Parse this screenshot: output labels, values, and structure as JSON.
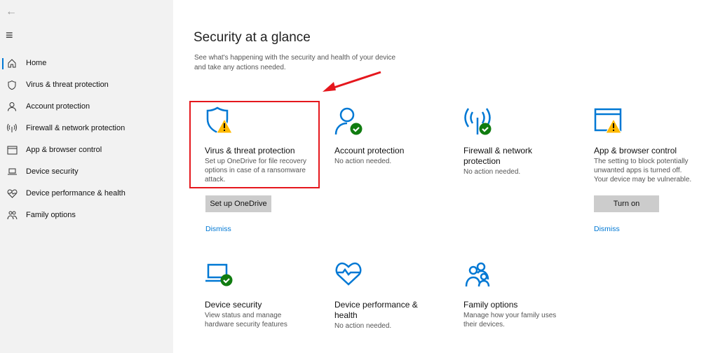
{
  "sidebar": {
    "back": "←",
    "menu": "≡",
    "items": [
      {
        "label": "Home",
        "icon": "home-icon"
      },
      {
        "label": "Virus & threat protection",
        "icon": "shield-icon"
      },
      {
        "label": "Account protection",
        "icon": "person-icon"
      },
      {
        "label": "Firewall & network protection",
        "icon": "antenna-icon"
      },
      {
        "label": "App & browser control",
        "icon": "browser-window-icon"
      },
      {
        "label": "Device security",
        "icon": "laptop-icon"
      },
      {
        "label": "Device performance & health",
        "icon": "heart-icon"
      },
      {
        "label": "Family options",
        "icon": "family-icon"
      }
    ]
  },
  "main": {
    "title": "Security at a glance",
    "subtitle": "See what's happening with the security and health of your device and take any actions needed.",
    "cards": [
      {
        "title": "Virus & threat protection",
        "desc": "Set up OneDrive for file recovery options in case of a ransomware attack.",
        "status": "warning",
        "button": "Set up OneDrive",
        "dismiss": "Dismiss"
      },
      {
        "title": "Account protection",
        "desc": "No action needed.",
        "status": "ok"
      },
      {
        "title": "Firewall & network protection",
        "desc": "No action needed.",
        "status": "ok"
      },
      {
        "title": "App & browser control",
        "desc": "The setting to block potentially unwanted apps is turned off. Your device may be vulnerable.",
        "status": "warning",
        "button": "Turn on",
        "dismiss": "Dismiss"
      },
      {
        "title": "Device security",
        "desc": "View status and manage hardware security features",
        "status": "ok"
      },
      {
        "title": "Device performance & health",
        "desc": "No action needed.",
        "status": "none"
      },
      {
        "title": "Family options",
        "desc": "Manage how your family uses their devices.",
        "status": "none"
      }
    ]
  },
  "colors": {
    "accent": "#0078d4",
    "ok": "#107c10",
    "warning": "#ffb900",
    "highlight": "#e5171d"
  }
}
